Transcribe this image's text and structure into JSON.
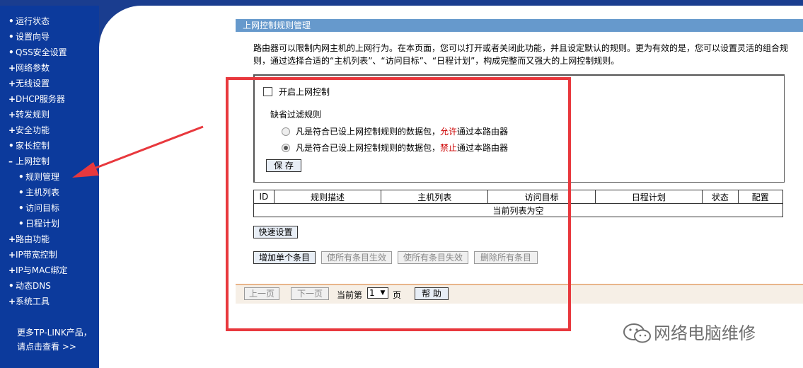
{
  "sidebar": {
    "items": [
      {
        "marker": "•",
        "label": "运行状态"
      },
      {
        "marker": "•",
        "label": "设置向导"
      },
      {
        "marker": "•",
        "label": "QSS安全设置"
      },
      {
        "marker": "+",
        "label": "网络参数"
      },
      {
        "marker": "+",
        "label": "无线设置"
      },
      {
        "marker": "+",
        "label": "DHCP服务器"
      },
      {
        "marker": "+",
        "label": "转发规则"
      },
      {
        "marker": "+",
        "label": "安全功能"
      },
      {
        "marker": "•",
        "label": "家长控制"
      },
      {
        "marker": "–",
        "label": "上网控制"
      },
      {
        "marker": "•",
        "label": "规则管理"
      },
      {
        "marker": "•",
        "label": "主机列表"
      },
      {
        "marker": "•",
        "label": "访问目标"
      },
      {
        "marker": "•",
        "label": "日程计划"
      },
      {
        "marker": "+",
        "label": "路由功能"
      },
      {
        "marker": "+",
        "label": "IP带宽控制"
      },
      {
        "marker": "+",
        "label": "IP与MAC绑定"
      },
      {
        "marker": "•",
        "label": "动态DNS"
      },
      {
        "marker": "+",
        "label": "系统工具"
      }
    ],
    "promo_line1": "更多TP-LINK产品，",
    "promo_line2": "请点击查看 >>"
  },
  "panel": {
    "title": "上网控制规则管理",
    "intro": "路由器可以限制内网主机的上网行为。在本页面，您可以打开或者关闭此功能，并且设定默认的规则。更为有效的是，您可以设置灵活的组合规则，通过选择合适的“主机列表”、“访问目标”、“日程计划”，构成完整而又强大的上网控制规则。",
    "enable_label": "开启上网控制",
    "enable_checked": false,
    "default_rule_label": "缺省过滤规则",
    "rule_allow_prefix": "凡是符合已设上网控制规则的数据包，",
    "rule_allow_keyword": "允许",
    "rule_allow_suffix": "通过本路由器",
    "rule_deny_prefix": "凡是符合已设上网控制规则的数据包，",
    "rule_deny_keyword": "禁止",
    "rule_deny_suffix": "通过本路由器",
    "selected_rule": "deny",
    "save_label": "保 存"
  },
  "table": {
    "headers": [
      "ID",
      "规则描述",
      "主机列表",
      "访问目标",
      "日程计划",
      "状态",
      "配置"
    ],
    "empty_text": "当前列表为空"
  },
  "buttons": {
    "quick_setup": "快速设置",
    "add_entry": "增加单个条目",
    "enable_all": "使所有条目生效",
    "disable_all": "使所有条目失效",
    "delete_all": "删除所有条目"
  },
  "pager": {
    "prev": "上一页",
    "next": "下一页",
    "current_label": "当前第",
    "page_value": "1",
    "page_unit": "页",
    "help": "帮 助"
  },
  "watermark": {
    "text": "网络电脑维修"
  },
  "colors": {
    "sidebar_bg": "#0c3a9c",
    "panel_title_bg": "#6699cc",
    "highlight_red": "#e8383d",
    "deny_red": "#cc0000"
  }
}
